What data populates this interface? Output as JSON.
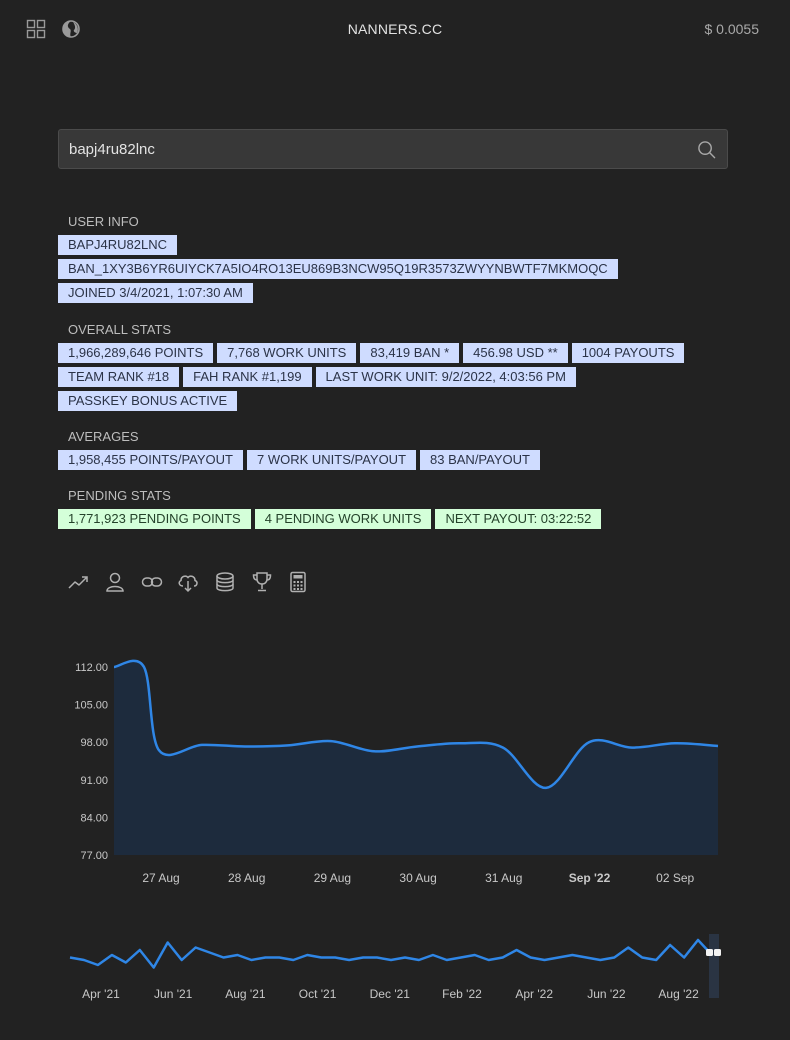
{
  "header": {
    "title": "NANNERS.CC",
    "price": "$ 0.0055",
    "icons": [
      "grid-icon",
      "globe-icon"
    ]
  },
  "search": {
    "value": "bapj4ru82lnc",
    "placeholder": ""
  },
  "user_info": {
    "title": "USER INFO",
    "tags": [
      "BAPJ4RU82LNC",
      "BAN_1XY3B6YR6UIYCK7A5IO4RO13EU869B3NCW95Q19R3573ZWYYNBWTF7MKMOQC",
      "JOINED 3/4/2021, 1:07:30 AM"
    ]
  },
  "overall_stats": {
    "title": "OVERALL STATS",
    "rows": [
      [
        "1,966,289,646 POINTS",
        "7,768 WORK UNITS",
        "83,419 BAN *",
        "456.98 USD **",
        "1004 PAYOUTS"
      ],
      [
        "TEAM RANK #18",
        "FAH RANK #1,199",
        "LAST WORK UNIT: 9/2/2022, 4:03:56 PM"
      ],
      [
        "PASSKEY BONUS ACTIVE"
      ]
    ]
  },
  "averages": {
    "title": "AVERAGES",
    "tags": [
      "1,958,455 POINTS/PAYOUT",
      "7 WORK UNITS/PAYOUT",
      "83 BAN/PAYOUT"
    ]
  },
  "pending_stats": {
    "title": "PENDING STATS",
    "tags": [
      "1,771,923 PENDING POINTS",
      "4 PENDING WORK UNITS",
      "NEXT PAYOUT: 03:22:52"
    ]
  },
  "toolbar_icons": [
    "trend-icon",
    "user-icon",
    "link-icon",
    "cloud-download-icon",
    "database-icon",
    "trophy-icon",
    "calculator-icon"
  ],
  "colors": {
    "accent": "#2f86e6",
    "chart_fill": "#1d2b3d",
    "tag_blue": "#cfdcff",
    "tag_green": "#d4ffd9"
  },
  "chart_data": {
    "type": "area",
    "title": "",
    "xlabel": "",
    "ylabel": "",
    "ylim": [
      77,
      112
    ],
    "y_ticks": [
      "112.00",
      "105.00",
      "98.00",
      "91.00",
      "84.00",
      "77.00"
    ],
    "x_tick_labels": [
      "27 Aug",
      "28 Aug",
      "29 Aug",
      "30 Aug",
      "31 Aug",
      "Sep '22",
      "02 Sep"
    ],
    "x": [
      "26 Aug 12:00",
      "26 Aug 18:00",
      "27 Aug 00:00",
      "27 Aug 12:00",
      "28 Aug 00:00",
      "28 Aug 12:00",
      "29 Aug 00:00",
      "29 Aug 12:00",
      "30 Aug 00:00",
      "30 Aug 12:00",
      "31 Aug 00:00",
      "31 Aug 12:00",
      "1 Sep 00:00",
      "1 Sep 12:00",
      "2 Sep 00:00",
      "2 Sep 12:00"
    ],
    "series": [
      {
        "values": [
          112,
          112,
          96.5,
          97.5,
          97.2,
          97.4,
          98.2,
          96.3,
          97.2,
          97.8,
          97.0,
          89.5,
          98.0,
          97.0,
          97.8,
          97.3
        ]
      }
    ],
    "navigator": {
      "x_tick_labels": [
        "Apr '21",
        "Jun '21",
        "Aug '21",
        "Oct '21",
        "Dec '21",
        "Feb '22",
        "Apr '22",
        "Jun '22",
        "Aug '22"
      ],
      "values": [
        97,
        96,
        94,
        98,
        95,
        100,
        93,
        103,
        96,
        101,
        99,
        97,
        98,
        96,
        97,
        97,
        96,
        98,
        97,
        97,
        96,
        97,
        97,
        96,
        97,
        96,
        98,
        96,
        97,
        98,
        96,
        97,
        100,
        97,
        96,
        97,
        98,
        97,
        96,
        97,
        101,
        97,
        96,
        102,
        97,
        104,
        98
      ]
    }
  }
}
